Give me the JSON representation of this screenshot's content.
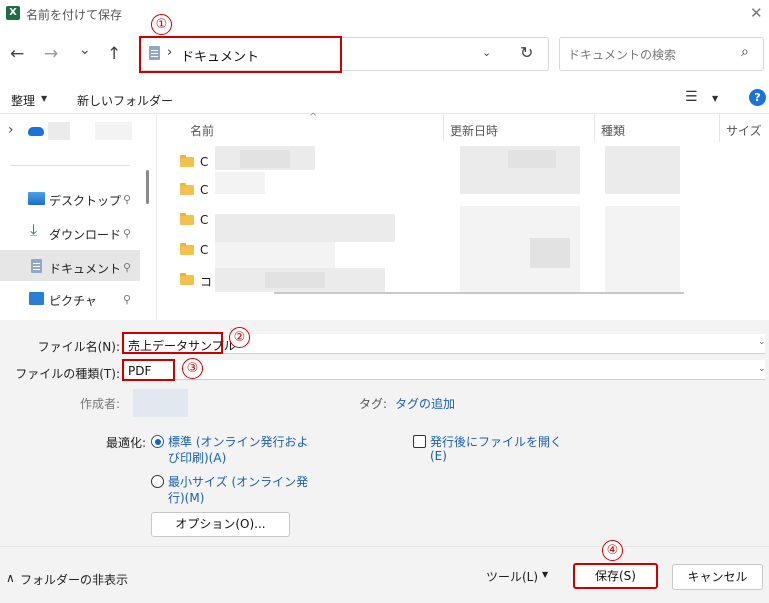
{
  "window": {
    "app_icon_letter": "X",
    "title": "名前を付けて保存",
    "close_glyph": "✕"
  },
  "nav": {
    "back_glyph": "←",
    "forward_glyph": "→",
    "recent_glyph": "⌄",
    "up_glyph": "↑"
  },
  "address": {
    "separator": "›",
    "path": "ドキュメント",
    "dropdown_glyph": "⌄",
    "refresh_glyph": "↻"
  },
  "search": {
    "placeholder": "ドキュメントの検索",
    "icon_glyph": "⌕"
  },
  "toolbar": {
    "organize_label": "整理",
    "organize_caret": "▼",
    "new_folder_label": "新しいフォルダー",
    "view_glyph": "☰",
    "view_caret": "▼",
    "help_glyph": "?"
  },
  "sidebar": {
    "expand_glyph": "›",
    "items": [
      {
        "label": "デスクトップ",
        "icon": "desktop-icon",
        "pin": "📌"
      },
      {
        "label": "ダウンロード",
        "icon": "download-icon",
        "pin": "📌"
      },
      {
        "label": "ドキュメント",
        "icon": "documents-icon",
        "pin": "📌"
      },
      {
        "label": "ピクチャ",
        "icon": "pictures-icon",
        "pin": "📌"
      }
    ]
  },
  "file_list": {
    "columns": [
      "名前",
      "更新日時",
      "種類",
      "サイズ"
    ],
    "sort_glyph": "^",
    "rows": [
      {
        "name_visible": "C"
      },
      {
        "name_visible": "C"
      },
      {
        "name_visible": "C"
      },
      {
        "name_visible": "C"
      },
      {
        "name_visible": "コ"
      }
    ]
  },
  "form": {
    "filename_label": "ファイル名(N):",
    "filename_value": "売上データサンプル",
    "filetype_label": "ファイルの種類(T):",
    "filetype_value": "PDF",
    "author_label": "作成者:",
    "tags_label": "タグ:",
    "tags_link": "タグの追加",
    "optimize_label": "最適化:",
    "radio_standard": "標準 (オンライン発行および印刷)(A)",
    "radio_standard_l1": "標準 (オンライン発行およ",
    "radio_standard_l2": "び印刷)(A)",
    "radio_min_l1": "最小サイズ (オンライン発",
    "radio_min_l2": "行)(M)",
    "open_after_l1": "発行後にファイルを開く",
    "open_after_l2": "(E)",
    "options_button": "オプション(O)...",
    "dropdown_glyph": "⌄"
  },
  "footer": {
    "hide_folders_caret": "∧",
    "hide_folders": "フォルダーの非表示",
    "tools_label": "ツール(L)",
    "tools_caret": "▼",
    "save_button": "保存(S)",
    "cancel_button": "キャンセル"
  },
  "annotations": {
    "step1": "①",
    "step2": "②",
    "step3": "③",
    "step4": "④"
  },
  "colors": {
    "accent_blue": "#1a5fb4",
    "annotation_red": "#cc0000",
    "excel_green": "#1d6f42",
    "folder_yellow": "#f2c14e"
  }
}
